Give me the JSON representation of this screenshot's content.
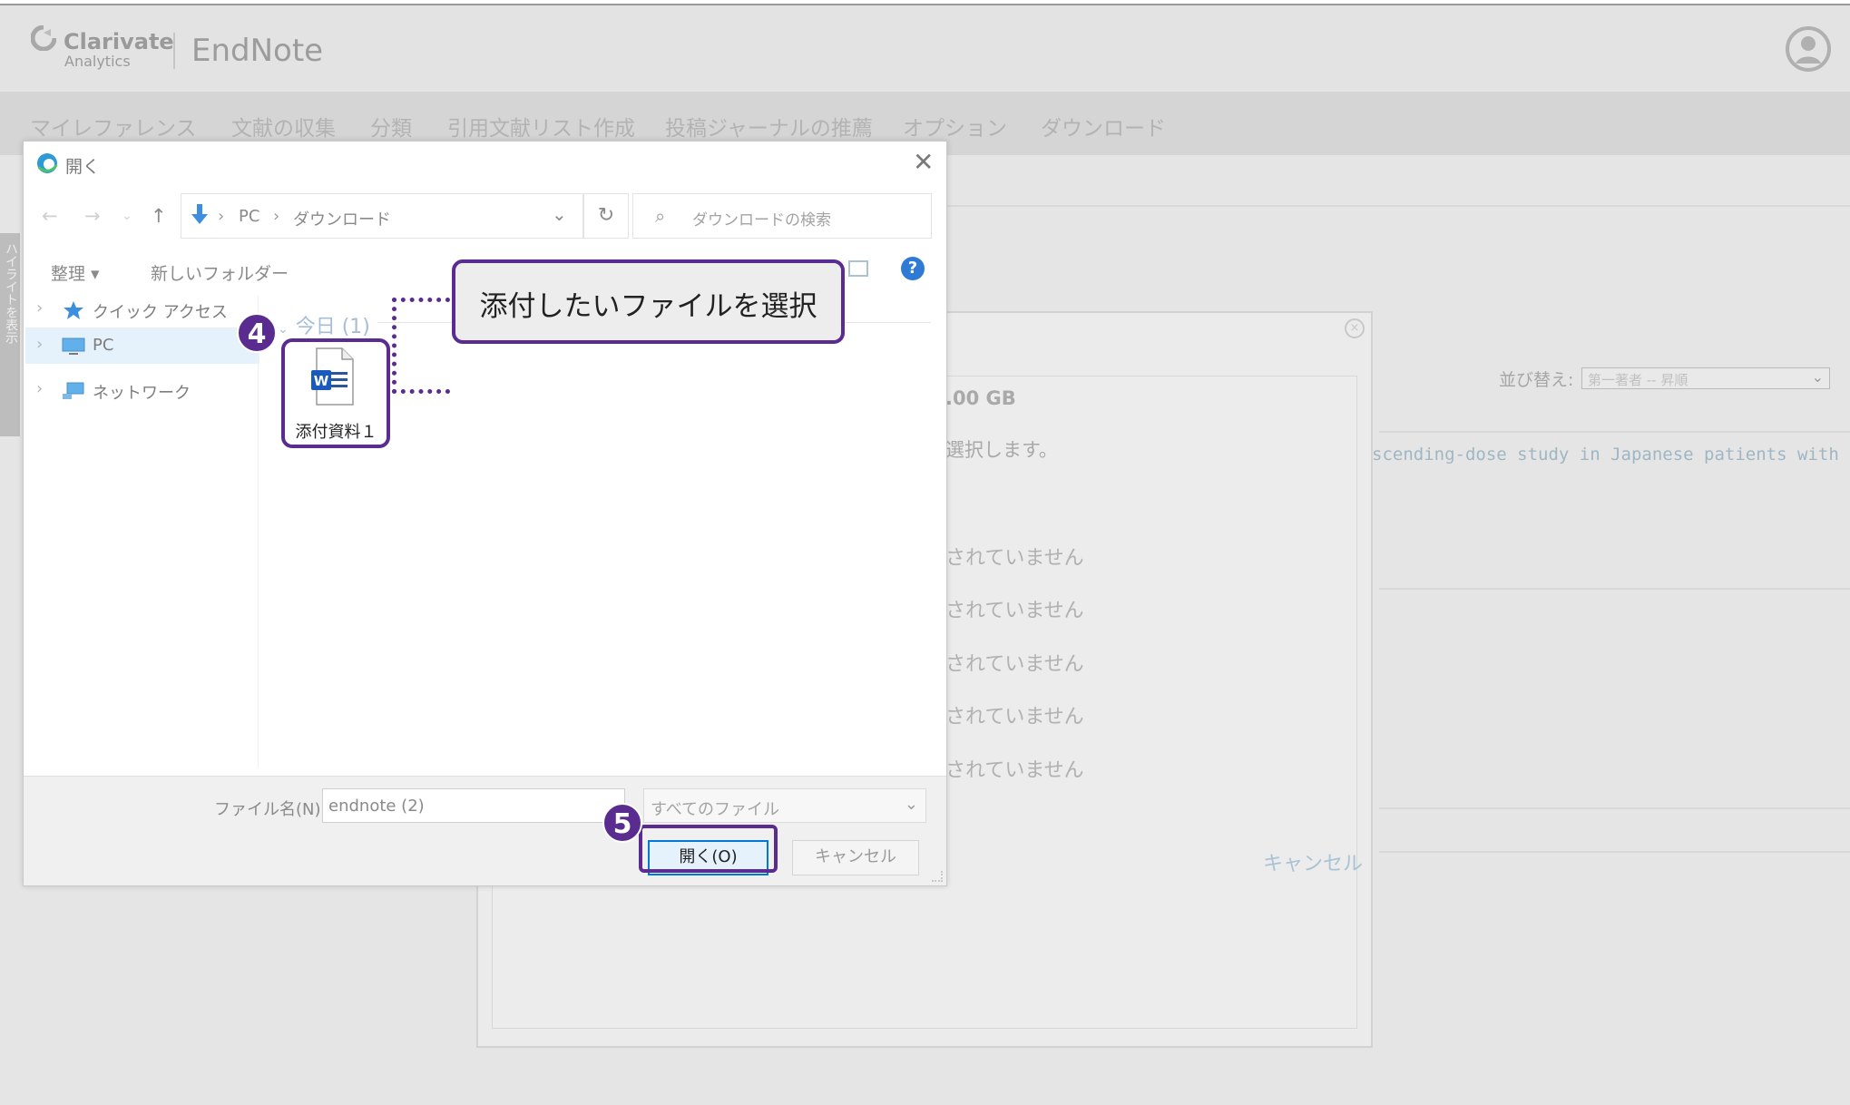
{
  "header": {
    "brand_name": "Clarivate",
    "brand_sub": "Analytics",
    "app_title": "EndNote"
  },
  "nav": {
    "items": [
      "マイレファレンス",
      "文献の収集",
      "分類",
      "引用文献リスト作成",
      "投稿ジャーナルの推薦",
      "オプション",
      "ダウンロード"
    ]
  },
  "background": {
    "side_tab": "ハイライトを表示",
    "sort_label": "並び替え:",
    "sort_value": "第一著者 -- 昇順",
    "reference_snippet": "scending-dose study in Japanese patients with",
    "quota": ".00 GB",
    "instruction": "選択します。",
    "status_lines": [
      "されていません",
      "されていません",
      "されていません",
      "されていません",
      "されていません"
    ],
    "cancel_link": "キャンセル"
  },
  "file_dialog": {
    "title": "開く",
    "breadcrumb": [
      "PC",
      "ダウンロード"
    ],
    "search_placeholder": "ダウンロードの検索",
    "organize": "整理 ▾",
    "new_folder": "新しいフォルダー",
    "tree": [
      {
        "label": "クイック アクセス",
        "icon": "star-icon"
      },
      {
        "label": "PC",
        "icon": "computer-icon"
      },
      {
        "label": "ネットワーク",
        "icon": "network-icon"
      }
    ],
    "group_header": "今日 (1)",
    "file": {
      "name": "添付資料１",
      "icon": "word-document-icon"
    },
    "filename_label": "ファイル名(N):",
    "filename_value": "endnote (2)",
    "filetype_value": "すべてのファイル",
    "open_button": "開く(O)",
    "cancel_button": "キャンセル"
  },
  "annotations": {
    "step4": "4",
    "step5": "5",
    "callout": "添付したいファイルを選択"
  },
  "colors": {
    "accent_purple": "#5b2c8f",
    "windows_blue": "#0078d7",
    "selection_blue": "#e5f1fb"
  }
}
